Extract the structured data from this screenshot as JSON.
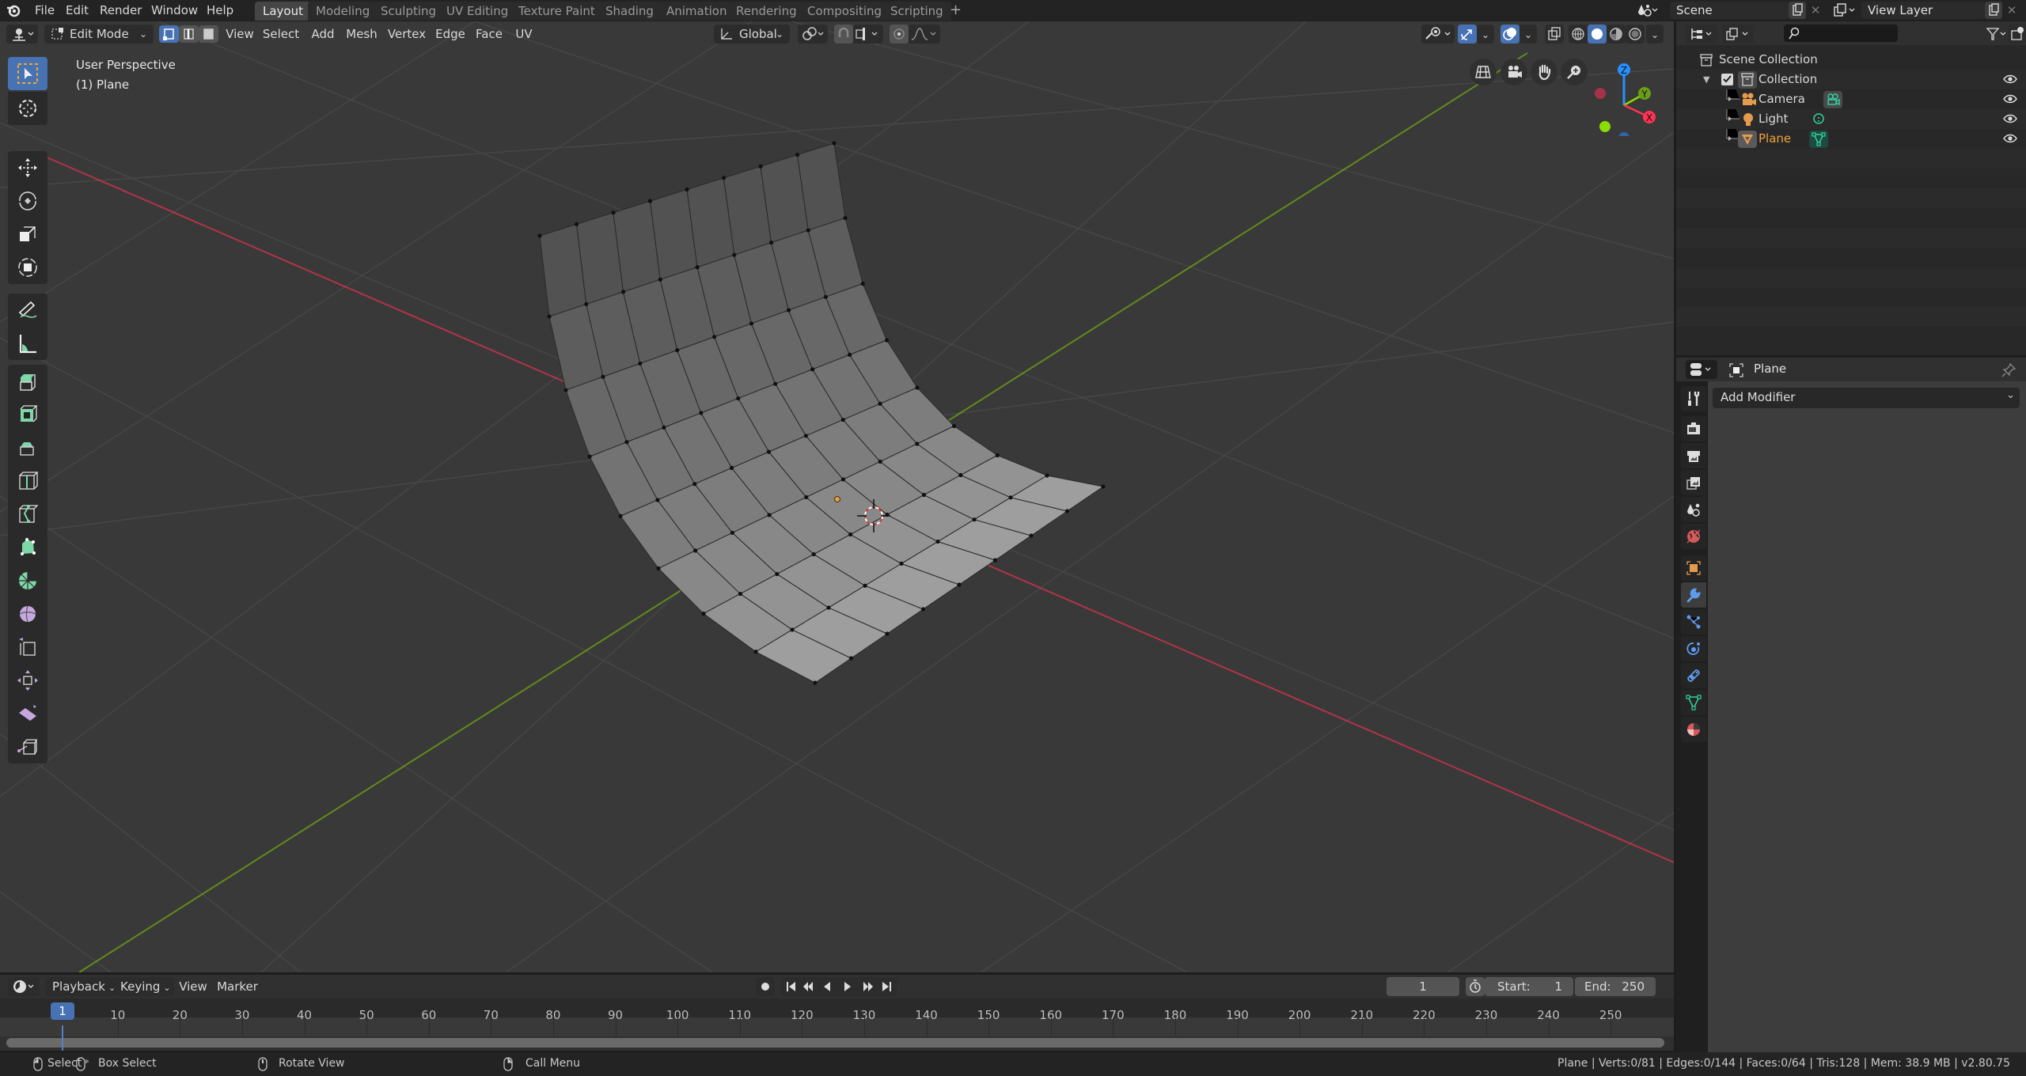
{
  "topbar": {
    "menus": [
      "File",
      "Edit",
      "Render",
      "Window",
      "Help"
    ],
    "workspaces": [
      "Layout",
      "Modeling",
      "Sculpting",
      "UV Editing",
      "Texture Paint",
      "Shading",
      "Animation",
      "Rendering",
      "Compositing",
      "Scripting"
    ],
    "active_workspace": "Layout",
    "add_workspace": "+",
    "scene": "Scene",
    "view_layer": "View Layer"
  },
  "viewport_header": {
    "mode": "Edit Mode",
    "menus": [
      "View",
      "Select",
      "Add",
      "Mesh",
      "Vertex",
      "Edge",
      "Face",
      "UV"
    ],
    "transform_orientation": "Global",
    "select_modes": [
      "vertex",
      "edge",
      "face"
    ],
    "active_select_mode": "vertex"
  },
  "viewport": {
    "view_name": "User Perspective",
    "object_info": "(1) Plane",
    "gizmo_axes": [
      "Z",
      "Y",
      "X"
    ],
    "colors": {
      "x_axis": "#ff3352",
      "y_axis": "#8bdc00",
      "z_axis": "#2890ff",
      "background": "#393939",
      "mesh_face": "#9a9a9a"
    }
  },
  "toolbar": {
    "tools": [
      "select-box",
      "cursor",
      "move",
      "rotate",
      "scale",
      "transform",
      "annotate",
      "measure",
      "extrude-region",
      "inset-faces",
      "bevel",
      "loop-cut",
      "knife",
      "poly-build",
      "spin",
      "smooth",
      "edge-slide",
      "shrink-fatten",
      "shear",
      "rip-region"
    ],
    "active_tool": "select-box"
  },
  "outliner": {
    "search_placeholder": "",
    "root": "Scene Collection",
    "collection": "Collection",
    "objects": [
      {
        "name": "Camera",
        "type": "camera",
        "selected": false
      },
      {
        "name": "Light",
        "type": "light",
        "selected": false
      },
      {
        "name": "Plane",
        "type": "mesh",
        "selected": true
      }
    ]
  },
  "properties": {
    "object_name": "Plane",
    "add_modifier_label": "Add Modifier",
    "tabs": [
      "tool",
      "render",
      "output",
      "view-layer",
      "scene",
      "world",
      "object",
      "modifiers",
      "particles",
      "physics",
      "constraints",
      "data",
      "material"
    ],
    "active_tab": "modifiers"
  },
  "timeline": {
    "menus": [
      "Playback",
      "Keying",
      "View",
      "Marker"
    ],
    "current_frame": "1",
    "start_label": "Start:",
    "start": "1",
    "end_label": "End:",
    "end": "250",
    "ruler_ticks": [
      "1",
      "10",
      "20",
      "30",
      "40",
      "50",
      "60",
      "70",
      "80",
      "90",
      "100",
      "110",
      "120",
      "130",
      "140",
      "150",
      "160",
      "170",
      "180",
      "190",
      "200",
      "210",
      "220",
      "230",
      "240",
      "250"
    ]
  },
  "statusbar": {
    "select": "Select",
    "box_select": "Box Select",
    "rotate_view": "Rotate View",
    "call_menu": "Call Menu",
    "stats": "Plane | Verts:0/81 | Edges:0/144 | Faces:0/64 | Tris:128 | Mem: 38.9 MB | v2.80.75"
  }
}
